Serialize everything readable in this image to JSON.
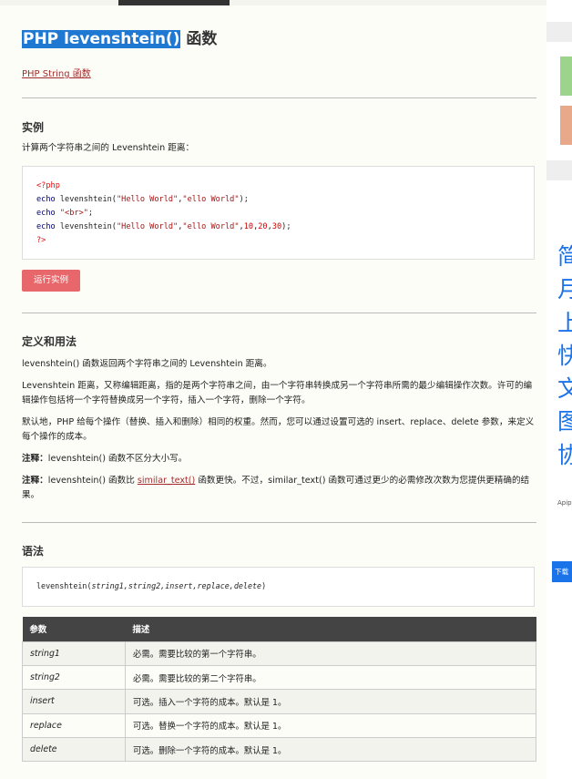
{
  "page": {
    "title_selected": "PHP levenshtein()",
    "title_rest": " 函数",
    "back_link": "PHP String 函数"
  },
  "example": {
    "heading": "实例",
    "desc": "计算两个字符串之间的 Levenshtein 距离：",
    "code": {
      "l1": "<?php",
      "l2_a": "echo ",
      "l2_b": "levenshtein(",
      "l2_c": "\"Hello World\"",
      "l2_d": ",",
      "l2_e": "\"ello World\"",
      "l2_f": ");",
      "l3_a": "echo ",
      "l3_b": "\"<br>\"",
      "l3_c": ";",
      "l4_a": "echo ",
      "l4_b": "levenshtein(",
      "l4_c": "\"Hello World\"",
      "l4_d": ",",
      "l4_e": "\"ello World\"",
      "l4_f": ",",
      "l4_g": "10",
      "l4_h": ",",
      "l4_i": "20",
      "l4_j": ",",
      "l4_k": "30",
      "l4_l": ");",
      "l5": "?>"
    },
    "run_button": "运行实例"
  },
  "definition": {
    "heading": "定义和用法",
    "p1": "levenshtein() 函数返回两个字符串之间的 Levenshtein 距离。",
    "p2": "Levenshtein 距离，又称编辑距离，指的是两个字符串之间，由一个字符串转换成另一个字符串所需的最少编辑操作次数。许可的编辑操作包括将一个字符替换成另一个字符，插入一个字符，删除一个字符。",
    "p3": "默认地，PHP 给每个操作（替换、插入和删除）相同的权重。然而，您可以通过设置可选的 insert、replace、delete 参数，来定义每个操作的成本。",
    "note1_label": "注释：",
    "note1": "levenshtein() 函数不区分大小写。",
    "note2_label": "注释：",
    "note2_a": "levenshtein() 函数比 ",
    "note2_link": "similar_text()",
    "note2_b": " 函数更快。不过，similar_text() 函数可通过更少的必需修改次数为您提供更精确的结果。"
  },
  "syntax": {
    "heading": "语法",
    "fn": "levenshtein(",
    "args": "string1,string2,insert,replace,delete",
    "close": ")"
  },
  "table": {
    "headers": [
      "参数",
      "描述"
    ],
    "rows": [
      {
        "param": "string1",
        "desc": "必需。需要比较的第一个字符串。"
      },
      {
        "param": "string2",
        "desc": "必需。需要比较的第二个字符串。"
      },
      {
        "param": "insert",
        "desc": "可选。插入一个字符的成本。默认是 1。"
      },
      {
        "param": "replace",
        "desc": "可选。替换一个字符的成本。默认是 1。"
      },
      {
        "param": "delete",
        "desc": "可选。删除一个字符的成本。默认是 1。"
      }
    ]
  },
  "sidebar_ad": {
    "chars": [
      "简",
      "月",
      "上",
      "快",
      "文",
      "图",
      "协"
    ],
    "small": "Apip",
    "button": "下载"
  }
}
